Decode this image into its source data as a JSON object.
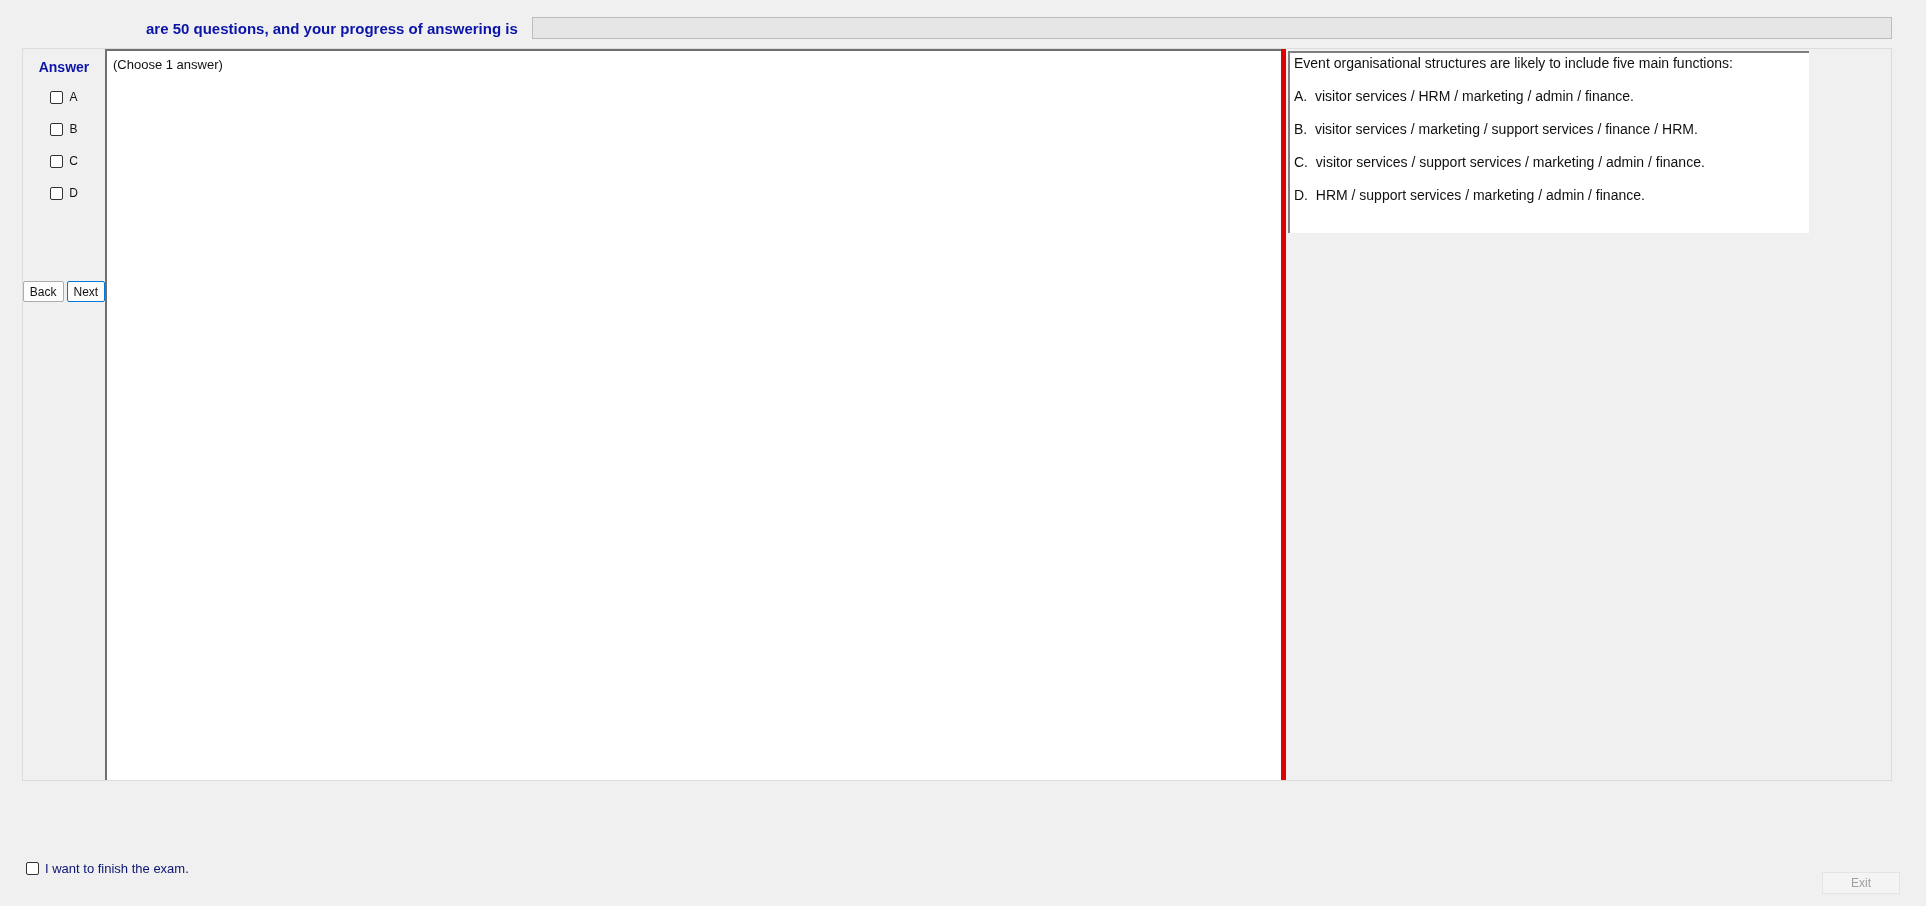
{
  "header": {
    "text": "are 50 questions, and your progress of answering is",
    "progress": {
      "level": 0
    }
  },
  "answer_panel": {
    "title": "Answer",
    "options": [
      {
        "label": "A",
        "checked": false
      },
      {
        "label": "B",
        "checked": false
      },
      {
        "label": "C",
        "checked": false
      },
      {
        "label": "D",
        "checked": false
      }
    ],
    "buttons": [
      {
        "label": "Back",
        "selected": false
      },
      {
        "label": "Next",
        "selected": true
      }
    ]
  },
  "question_area": {
    "instruction": "(Choose 1 answer)"
  },
  "question": {
    "stem": "Event organisational structures are likely to include five main functions:",
    "choices": [
      "A.  visitor services / HRM / marketing / admin / finance.",
      "B.  visitor services / marketing / support services / finance / HRM.",
      "C.  visitor services / support services / marketing / admin / finance.",
      "D.  HRM / support services / marketing / admin / finance."
    ]
  },
  "footer": {
    "finish": {
      "label": "I want to finish the exam.",
      "checked": false
    },
    "exit": {
      "label": "Exit",
      "disabled": true
    }
  }
}
